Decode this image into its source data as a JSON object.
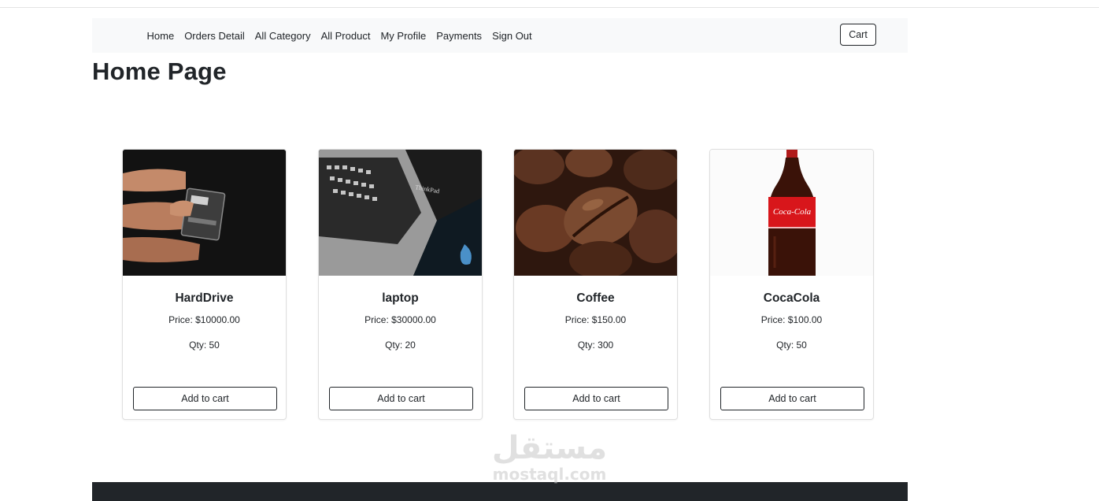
{
  "nav": {
    "links": [
      "Home",
      "Orders Detail",
      "All Category",
      "All Product",
      "My Profile",
      "Payments",
      "Sign Out"
    ],
    "cart_label": "Cart"
  },
  "page": {
    "title": "Home Page"
  },
  "products": [
    {
      "name": "HardDrive",
      "price": "Price: $10000.00",
      "qty": "Qty: 50",
      "button": "Add to cart"
    },
    {
      "name": "laptop",
      "price": "Price: $30000.00",
      "qty": "Qty: 20",
      "button": "Add to cart"
    },
    {
      "name": "Coffee",
      "price": "Price: $150.00",
      "qty": "Qty: 300",
      "button": "Add to cart"
    },
    {
      "name": "CocaCola",
      "price": "Price: $100.00",
      "qty": "Qty: 50",
      "button": "Add to cart"
    }
  ],
  "watermark": {
    "arabic": "مستقل",
    "latin": "mostaql.com"
  },
  "colors": {
    "navbar_bg": "#f8f9fa",
    "footer_bg": "#212529",
    "text": "#212529"
  }
}
